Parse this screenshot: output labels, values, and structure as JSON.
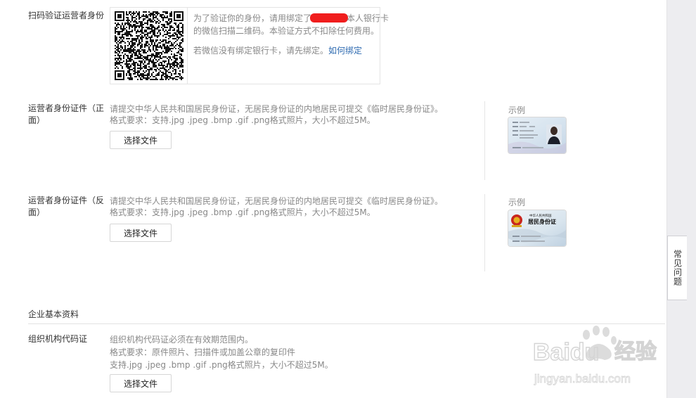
{
  "qr_section": {
    "label": "扫码验证运营者身份",
    "line1_a": "为了验证你的身份，请用绑定了",
    "line1_b": "本人银行卡",
    "line2": "的微信扫描二维码。本验证方式不扣除任何费用。",
    "line3": "若微信没有绑定银行卡，请先绑定。",
    "bind_link": "如何绑定"
  },
  "id_front": {
    "label_1": "运营者身份证件（正",
    "label_2": "面）",
    "desc_1": "请提交中华人民共和国居民身份证，无居民身份证的内地居民可提交《临时居民身份证》。",
    "desc_2": "格式要求：支持.jpg .jpeg .bmp .gif .png格式照片，大小不超过5M。",
    "button": "选择文件",
    "example_label": "示例"
  },
  "id_back": {
    "label_1": "运营者身份证件（反",
    "label_2": "面）",
    "desc_1": "请提交中华人民共和国居民身份证，无居民身份证的内地居民可提交《临时居民身份证》。",
    "desc_2": "格式要求：支持.jpg .jpeg .bmp .gif .png格式照片，大小不超过5M。",
    "button": "选择文件",
    "example_label": "示例",
    "card_title_small": "中华人民共和国",
    "card_title_big": "居民身份证"
  },
  "enterprise": {
    "section_title": "企业基本资料",
    "label": "组织机构代码证",
    "desc_1": "组织机构代码证必须在有效期范围内。",
    "desc_2": "格式要求：原件照片、扫描件或加盖公章的复印件",
    "desc_3": "支持.jpg .jpeg .bmp .gif .png格式照片，大小不超过5M。",
    "button": "选择文件"
  },
  "faq_tab": "常见问题",
  "watermark": {
    "brand": "Baidu",
    "brand_cn": "经验",
    "url": "jingyan.baidu.com"
  },
  "colors": {
    "link": "#2f6bb1",
    "redaction": "#f01d1d",
    "muted_text": "#888888"
  }
}
